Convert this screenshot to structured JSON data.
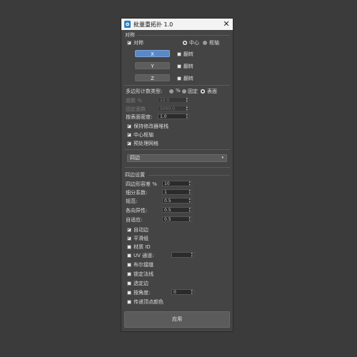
{
  "window": {
    "title": "批量重拓扑 1.0",
    "close_glyph": "✕",
    "icon": "app-icon"
  },
  "symmetry": {
    "group_label": "对称",
    "checkbox_label": "对称",
    "checked": true,
    "center_label": "中心",
    "pivot_label": "枢轴",
    "center_selected": true,
    "axes": [
      {
        "label": "X",
        "active": true,
        "flip_label": "翻转",
        "flip": false
      },
      {
        "label": "Y",
        "active": false,
        "flip_label": "翻转",
        "flip": false
      },
      {
        "label": "Z",
        "active": false,
        "flip_label": "翻转",
        "flip": false
      }
    ]
  },
  "poly_count": {
    "type_label": "多边形计数类型:",
    "percent_label": "%",
    "fixed_label": "固定",
    "surface_label": "表面",
    "selected": "surface",
    "face_count_label": "面数 %",
    "face_count_value": "22.0",
    "fixed_faces_label": "固定面数",
    "fixed_faces_value": "5000.0",
    "density_label": "按表面密度:",
    "density_value": "1.0"
  },
  "options": [
    {
      "label": "保持修改器堆栈",
      "checked": true
    },
    {
      "label": "中心枢轴",
      "checked": true
    },
    {
      "label": "预处理网格",
      "checked": true
    }
  ],
  "mode_dropdown": {
    "value": "四边",
    "caret": "▾"
  },
  "quad_settings": {
    "group_label": "四边设置",
    "fields": [
      {
        "label": "四边形容差 %",
        "value": "10"
      },
      {
        "label": "细分系数:",
        "value": "1"
      },
      {
        "label": "规范:",
        "value": "0.5"
      },
      {
        "label": "各向异性:",
        "value": "0.5"
      },
      {
        "label": "自适应:",
        "value": "0.5"
      }
    ],
    "checks": [
      {
        "label": "自动边",
        "checked": true,
        "dim": false
      },
      {
        "label": "平滑组",
        "checked": true,
        "dim": false
      },
      {
        "label": "材质 ID",
        "checked": false,
        "dim": false
      },
      {
        "label": "UV 通道:",
        "checked": false,
        "dim": false,
        "value": ""
      },
      {
        "label": "布尔接缝",
        "checked": false,
        "dim": false
      },
      {
        "label": "锁定法线",
        "checked": false,
        "dim": false
      },
      {
        "label": "选定边",
        "checked": false,
        "dim": false
      },
      {
        "label": "按角度:",
        "checked": false,
        "dim": false,
        "value": "0"
      },
      {
        "label": "传递顶点颜色",
        "checked": false,
        "dim": false
      }
    ]
  },
  "apply_label": "应用"
}
